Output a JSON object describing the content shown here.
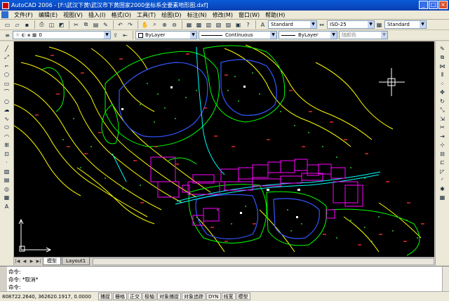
{
  "window": {
    "title": "AutoCAD 2006 - [F:\\武汉下黄\\武汉市下黄国家2000坐标系全要素地形图.dxf]"
  },
  "menu": [
    "文件(F)",
    "编辑(E)",
    "视图(V)",
    "插入(I)",
    "格式(O)",
    "工具(T)",
    "绘图(D)",
    "标注(N)",
    "修改(M)",
    "窗口(W)",
    "帮助(H)"
  ],
  "toolbar": {
    "text_style": "Standard",
    "dim_style": "ISO-25",
    "table_style": "Standard",
    "layer": "0",
    "color": "ByLayer",
    "linetype": "Continuous",
    "lineweight": "ByLayer",
    "plotstyle": "随颜色"
  },
  "tabs": {
    "model": "模型",
    "layout1": "Layout1"
  },
  "command": {
    "line1": "命令:",
    "line2": "命令: *取消*",
    "line3": "命令:"
  },
  "status": {
    "coords": "808722.2640, 362620.1917, 0.0000",
    "buttons": [
      "捕捉",
      "栅格",
      "正交",
      "极轴",
      "对象捕捉",
      "对象追踪",
      "DYN",
      "线宽",
      "模型"
    ]
  },
  "colors": {
    "contour_yellow": "#ffff00",
    "contour_green": "#00ff00",
    "building_magenta": "#ff00ff",
    "road_cyan": "#00ffff",
    "lake_blue": "#0000ff",
    "label_red": "#ff0000"
  }
}
